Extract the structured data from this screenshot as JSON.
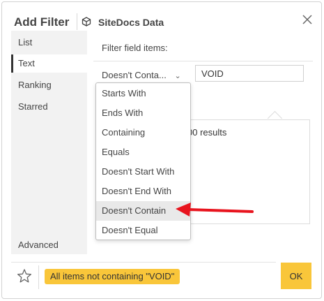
{
  "dialog": {
    "title": "Add Filter",
    "source_name": "SiteDocs Data"
  },
  "sidebar": {
    "items": [
      {
        "label": "List"
      },
      {
        "label": "Text"
      },
      {
        "label": "Ranking"
      },
      {
        "label": "Starred"
      }
    ],
    "active": "Text",
    "advanced_label": "Advanced"
  },
  "main": {
    "filter_label": "Filter field items:",
    "operator": {
      "selected": "Doesn't Conta...",
      "options": [
        "Starts With",
        "Ends With",
        "Containing",
        "Equals",
        "Doesn't Start With",
        "Doesn't End With",
        "Doesn't Contain",
        "Doesn't Equal"
      ],
      "highlighted": "Doesn't Contain"
    },
    "value": "VOID",
    "results_text": "00 results"
  },
  "footer": {
    "summary": "All items not containing \"VOID\"",
    "ok_label": "OK"
  },
  "colors": {
    "accent": "#f9c63a",
    "arrow": "#e8141e",
    "highlight": "#e9e9e9"
  }
}
